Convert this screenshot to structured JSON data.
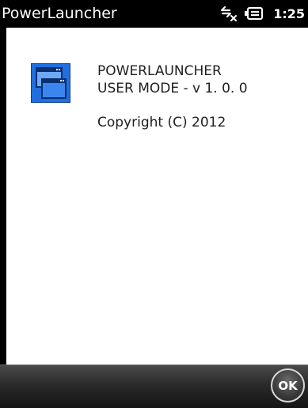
{
  "status_bar": {
    "app_title": "PowerLauncher",
    "time": "1:25",
    "icons": [
      "usb-disconnected-icon",
      "battery-icon"
    ]
  },
  "about": {
    "app_name": "POWERLAUNCHER",
    "mode_version": "USER MODE - v 1. 0. 0",
    "copyright": "Copyright (C) 2012",
    "icon": "app-windows-icon"
  },
  "softkey_bar": {
    "ok_label": "OK"
  },
  "colors": {
    "icon_blue": "#1f6fe0",
    "background": "#ffffff",
    "bar": "#000000"
  }
}
